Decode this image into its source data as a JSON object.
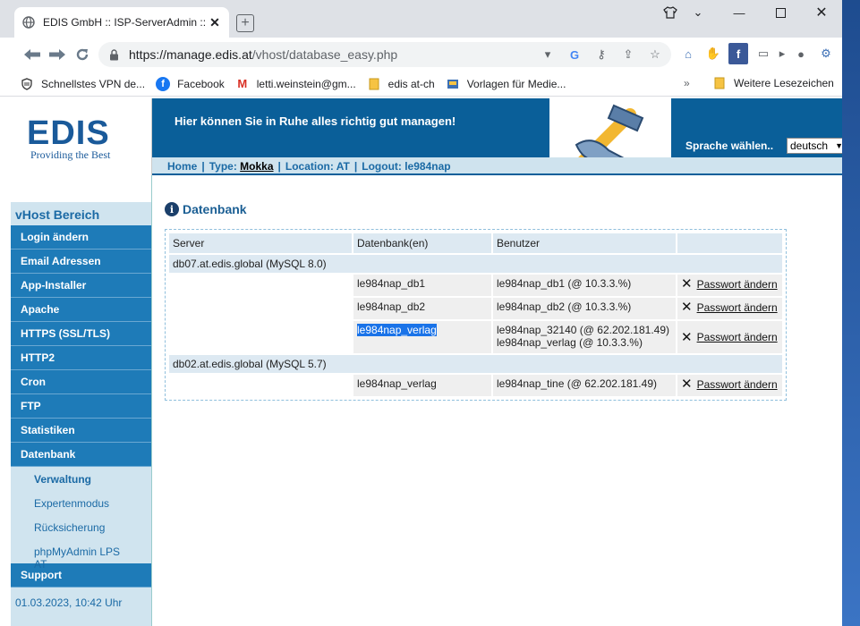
{
  "browser": {
    "tab_title": "EDIS GmbH :: ISP-ServerAdmin :: vl",
    "url_host": "https://manage.edis.at",
    "url_path": "/vhost/database_easy.php",
    "bookmarks": [
      {
        "label": "Schnellstes VPN de...",
        "icon": "shield-icon"
      },
      {
        "label": "Facebook",
        "icon": "facebook-icon"
      },
      {
        "label": "letti.weinstein@gm...",
        "icon": "gmail-icon"
      },
      {
        "label": "edis at-ch",
        "icon": "folder-icon"
      },
      {
        "label": "Vorlagen für Medie...",
        "icon": "template-icon"
      }
    ],
    "bookmarks_more": "»",
    "other_bookmarks": "Weitere Lesezeichen"
  },
  "header": {
    "logo": "EDIS",
    "logo_sub": "Providing the Best",
    "tagline": "Hier können Sie in Ruhe alles richtig gut managen!",
    "language_label": "Sprache wählen..",
    "language_value": "deutsch"
  },
  "crumb": {
    "home": "Home",
    "type_label": "Type:",
    "type_value": "Mokka",
    "location": "Location: AT",
    "logout": "Logout: le984nap"
  },
  "sidebar": {
    "title": "vHost Bereich",
    "items": [
      "Login ändern",
      "Email Adressen",
      "App-Installer",
      "Apache",
      "HTTPS (SSL/TLS)",
      "HTTP2",
      "Cron",
      "FTP",
      "Statistiken",
      "Datenbank"
    ],
    "subitems": [
      "Verwaltung",
      "Expertenmodus",
      "Rücksicherung",
      "phpMyAdmin LPS AT"
    ],
    "support": "Support",
    "datetime": "01.03.2023, 10:42 Uhr"
  },
  "content": {
    "title": "Datenbank",
    "columns": [
      "Server",
      "Datenbank(en)",
      "Benutzer",
      ""
    ],
    "servers": [
      {
        "name": "db07.at.edis.global (MySQL 8.0)",
        "rows": [
          {
            "db": "le984nap_db1",
            "users": [
              "le984nap_db1 (@ 10.3.3.%)"
            ],
            "action": "Passwort ändern"
          },
          {
            "db": "le984nap_db2",
            "users": [
              "le984nap_db2 (@ 10.3.3.%)"
            ],
            "action": "Passwort ändern"
          },
          {
            "db": "le984nap_verlag",
            "users": [
              "le984nap_32140 (@ 62.202.181.49)",
              "le984nap_verlag (@ 10.3.3.%)"
            ],
            "action": "Passwort ändern"
          }
        ]
      },
      {
        "name": "db02.at.edis.global (MySQL 5.7)",
        "rows": [
          {
            "db": "le984nap_verlag",
            "users": [
              "le984nap_tine (@ 62.202.181.49)"
            ],
            "action": "Passwort ändern"
          }
        ]
      }
    ]
  }
}
